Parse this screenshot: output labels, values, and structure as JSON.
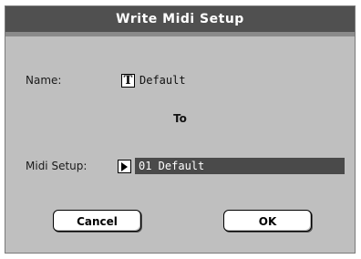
{
  "dialog": {
    "title": "Write Midi Setup"
  },
  "name_row": {
    "label": "Name:",
    "icon_glyph": "T",
    "icon": "text-edit-icon",
    "value": "Default"
  },
  "to_label": "To",
  "midi_setup_row": {
    "label": "Midi Setup:",
    "icon": "triangle-right-icon",
    "value": "01 Default"
  },
  "buttons": {
    "cancel": "Cancel",
    "ok": "OK"
  }
}
